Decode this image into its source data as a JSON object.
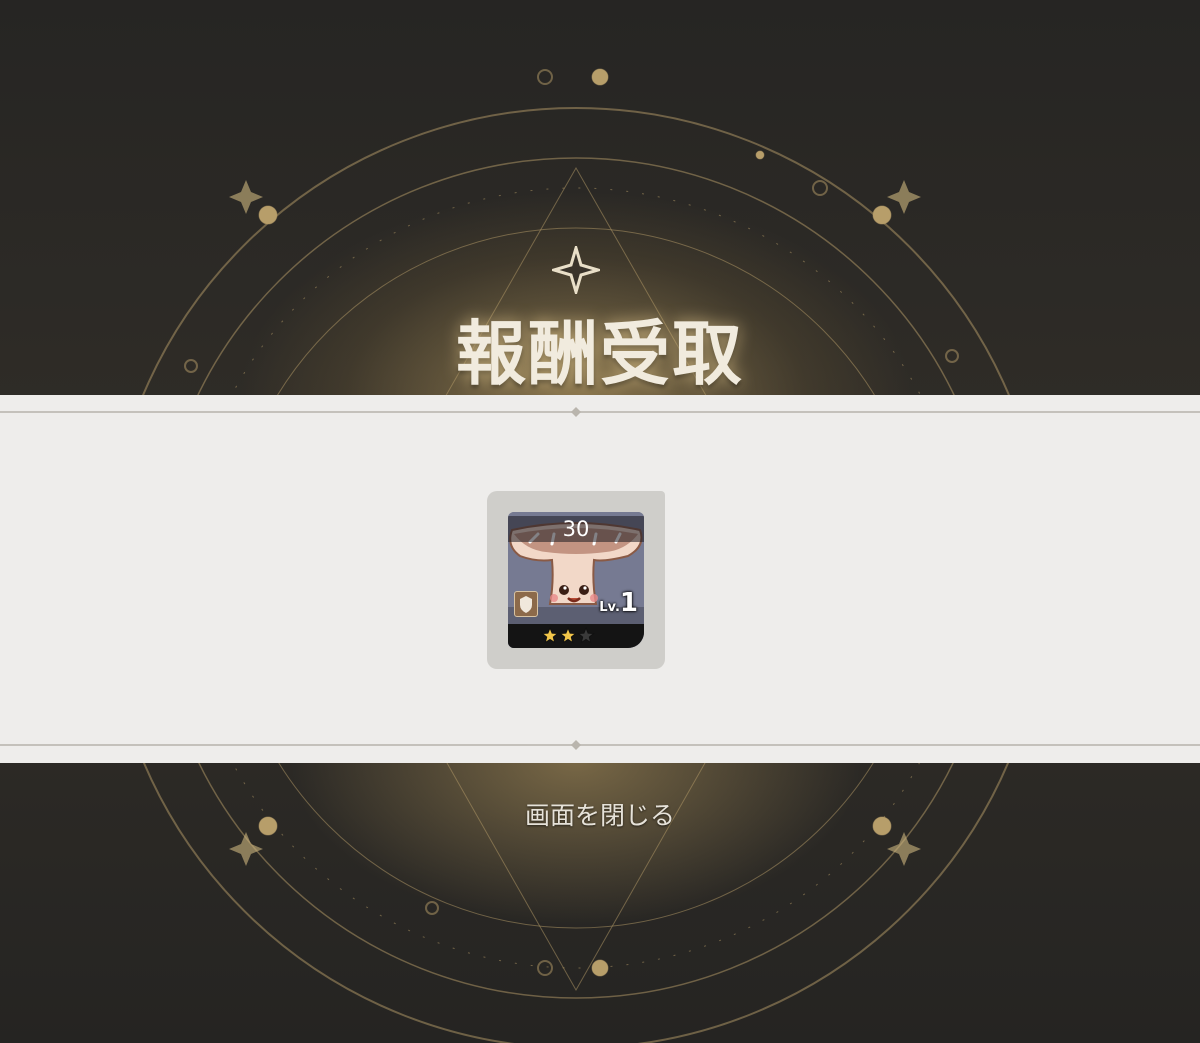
{
  "title": "報酬受取",
  "reward": {
    "count": "30",
    "level_prefix": "Lv.",
    "level_value": "1",
    "stars": 3,
    "stars_filled": 2,
    "icon": "mushroom-character-portrait"
  },
  "close_label": "画面を閉じる",
  "colors": {
    "accent_gold": "#d6b46e",
    "band": "#eeedeb",
    "star_filled": "#f2c64a",
    "star_empty": "#3a3a3a"
  }
}
